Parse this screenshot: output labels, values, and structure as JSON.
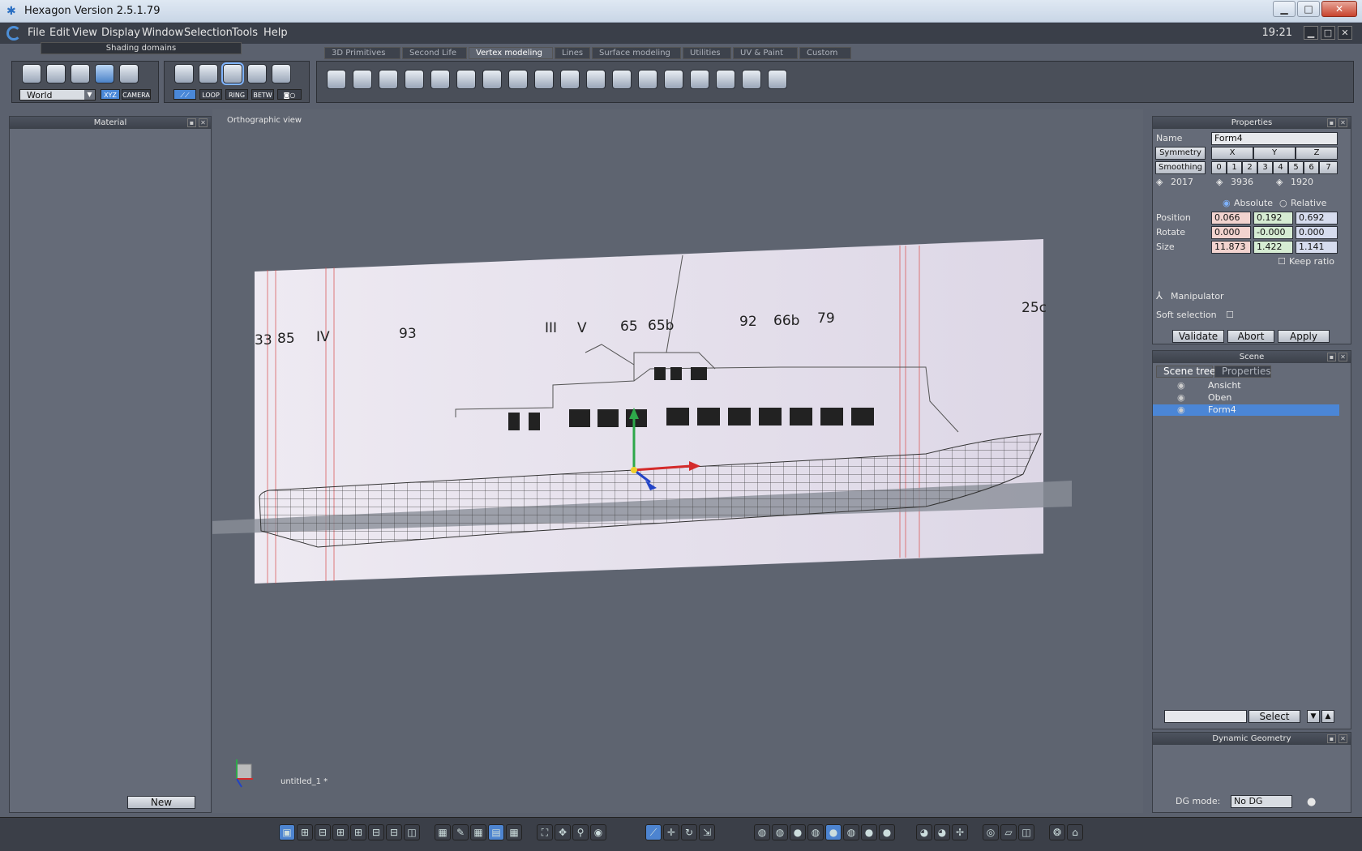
{
  "window": {
    "title": "Hexagon Version 2.5.1.79",
    "min": "▁",
    "max": "□",
    "close": "✕"
  },
  "menu": {
    "items": [
      "File",
      "Edit",
      "View",
      "Display",
      "Window",
      "Selection",
      "Tools",
      "Help"
    ],
    "time": "19:21"
  },
  "shading": {
    "label": "Shading domains"
  },
  "tabs": [
    "3D Primitives",
    "Second Life",
    "Vertex modeling",
    "Lines",
    "Surface modeling",
    "Utilities",
    "UV & Paint",
    "Custom"
  ],
  "active_tab": "Vertex modeling",
  "coord": {
    "world": "World",
    "xyz": "XYZ",
    "camera": "CAMERA",
    "loop": "LOOP",
    "ring": "RING",
    "betw": "BETW"
  },
  "material": {
    "title": "Material",
    "new_button": "New"
  },
  "viewport": {
    "label": "Orthographic view",
    "filename": "untitled_1 *",
    "blueprint_labels": [
      "33",
      "85",
      "IV",
      "93",
      "III",
      "V",
      "65",
      "65b",
      "92",
      "66b",
      "79",
      "25c"
    ]
  },
  "properties": {
    "title": "Properties",
    "name_label": "Name",
    "name_value": "Form4",
    "symmetry_label": "Symmetry",
    "sym_axes": [
      "X",
      "Y",
      "Z"
    ],
    "smoothing_label": "Smoothing",
    "smoothing_levels": [
      "0",
      "1",
      "2",
      "3",
      "4",
      "5",
      "6",
      "7"
    ],
    "counts": [
      "2017",
      "3936",
      "1920"
    ],
    "absolute": "Absolute",
    "relative": "Relative",
    "position_label": "Position",
    "position": [
      "0.066",
      "0.192",
      "0.692"
    ],
    "rotate_label": "Rotate",
    "rotate": [
      "0.000",
      "-0.000",
      "0.000"
    ],
    "size_label": "Size",
    "size": [
      "11.873",
      "1.422",
      "1.141"
    ],
    "keep_ratio": "Keep ratio",
    "manipulator": "Manipulator",
    "soft_selection": "Soft selection",
    "validate": "Validate",
    "abort": "Abort",
    "apply": "Apply"
  },
  "scene": {
    "title": "Scene",
    "tab_tree": "Scene tree",
    "tab_props": "Properties",
    "items": [
      "Ansicht",
      "Oben",
      "Form4"
    ],
    "select_button": "Select"
  },
  "dynamic_geometry": {
    "title": "Dynamic Geometry",
    "dg_label": "DG mode:",
    "dg_value": "No DG"
  }
}
